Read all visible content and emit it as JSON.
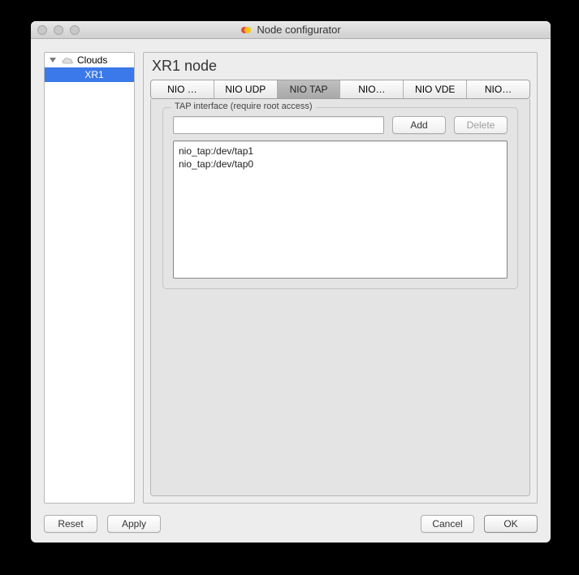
{
  "window": {
    "title": "Node configurator"
  },
  "sidebar": {
    "root_label": "Clouds",
    "items": [
      {
        "label": "XR1",
        "selected": true
      }
    ]
  },
  "content": {
    "title": "XR1 node",
    "tabs": [
      {
        "label": "NIO …"
      },
      {
        "label": "NIO UDP"
      },
      {
        "label": "NIO TAP",
        "active": true
      },
      {
        "label": "NIO…"
      },
      {
        "label": "NIO VDE"
      },
      {
        "label": "NIO…"
      }
    ],
    "tap_panel": {
      "group_label": "TAP interface (require root access)",
      "input_value": "",
      "add_label": "Add",
      "delete_label": "Delete",
      "items": [
        "nio_tap:/dev/tap1",
        "nio_tap:/dev/tap0"
      ]
    }
  },
  "footer": {
    "reset": "Reset",
    "apply": "Apply",
    "cancel": "Cancel",
    "ok": "OK"
  }
}
